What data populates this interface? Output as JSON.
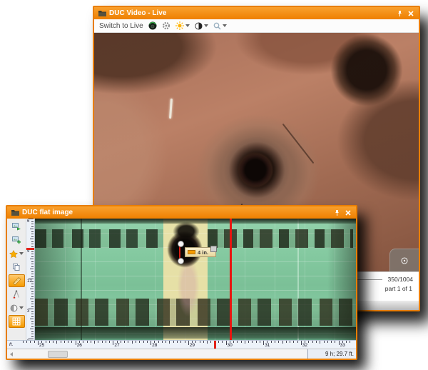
{
  "video_window": {
    "title": "DUC Video - Live",
    "toolbar": {
      "switch_to_live_label": "Switch to Live",
      "icons": [
        "pano-sphere-icon",
        "settings-gear-icon",
        "brightness-sun-icon",
        "contrast-icon",
        "zoom-magnifier-icon"
      ]
    },
    "footer": {
      "frame_counter": "350/1004",
      "part_label": "part 1 of 1"
    },
    "overlay_button_icon": "target-icon"
  },
  "flat_window": {
    "title": "DUC flat image",
    "toolbar_icons": [
      "export-image",
      "add-image",
      "star-rating",
      "copy-pages",
      "measure-ruler",
      "caliper-measure",
      "contrast-adjust",
      "grid-view"
    ],
    "selected_tools": [
      "measure-ruler",
      "grid-view"
    ],
    "measurement": {
      "label": "4 in."
    },
    "h_ruler": {
      "unit_label": "ft.",
      "ticks": [
        25,
        26,
        27,
        28,
        29,
        30,
        31,
        32,
        33
      ],
      "cursor_ft": 29.7,
      "frame_ft": 30.1
    },
    "v_ruler": {
      "labels": [
        "6",
        "9",
        "12",
        "3",
        "6"
      ],
      "cursor_label": "9"
    },
    "status_box": "9 h; 29.7 ft."
  },
  "colors": {
    "titlebar_orange": "#ee8000",
    "tool_selected_orange": "#f59b00",
    "measure_red": "#e32219",
    "flat_base_green": "#84c9a0",
    "pipe_copper": "#a8705a"
  }
}
